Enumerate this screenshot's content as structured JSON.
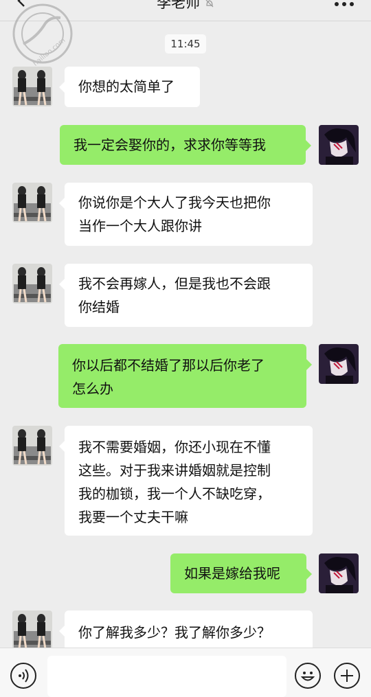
{
  "header": {
    "title": "李老师",
    "back_icon": "chevron-left-icon",
    "more_icon": "more-dots-icon",
    "muted_icon": "bell-muted-icon"
  },
  "watermark": {
    "text": "hailiao.com"
  },
  "timestamp": "11:45",
  "messages": [
    {
      "from": "them",
      "lines": [
        "你想的太简单了"
      ]
    },
    {
      "from": "me",
      "lines": [
        "我一定会娶你的，求求你等等我"
      ]
    },
    {
      "from": "them",
      "lines": [
        "你说你是个大人了我今天也把你",
        "当作一个大人跟你讲"
      ]
    },
    {
      "from": "them",
      "lines": [
        "我不会再嫁人，但是我也不会跟",
        "你结婚"
      ]
    },
    {
      "from": "me",
      "lines": [
        "你以后都不结婚了那以后你老了",
        "怎么办"
      ]
    },
    {
      "from": "them",
      "lines": [
        "我不需要婚姻，你还小现在不懂",
        "这些。对于我来讲婚姻就是控制",
        "我的枷锁，我一个人不缺吃穿，",
        "我要一个丈夫干嘛"
      ]
    },
    {
      "from": "me",
      "lines": [
        "如果是嫁给我呢"
      ]
    },
    {
      "from": "them",
      "lines": [
        "你了解我多少？我了解你多少？"
      ]
    }
  ],
  "input_bar": {
    "voice_icon": "voice-icon",
    "emoji_icon": "emoji-icon",
    "add_icon": "plus-icon",
    "message_value": ""
  },
  "colors": {
    "background": "#ededed",
    "incoming_bubble": "#ffffff",
    "outgoing_bubble": "#95ec69"
  }
}
